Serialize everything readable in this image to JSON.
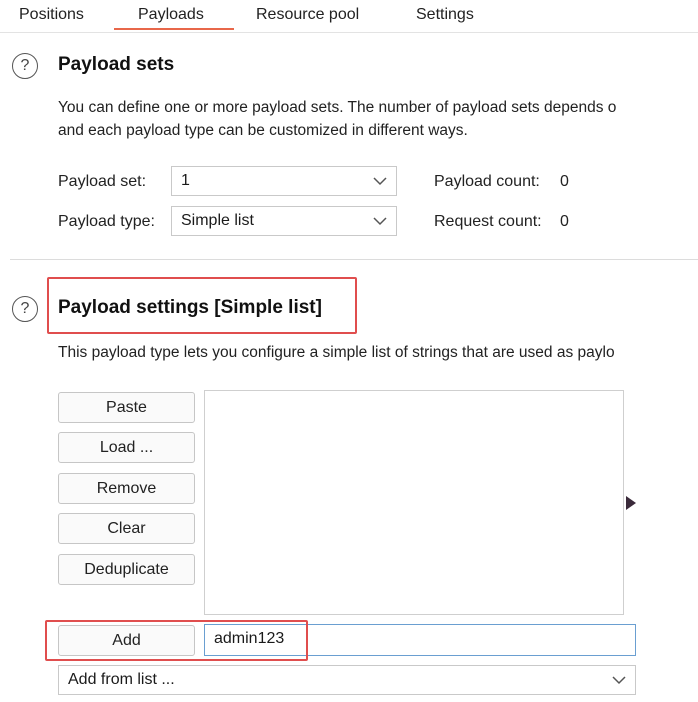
{
  "tabs": [
    {
      "label": "Positions"
    },
    {
      "label": "Payloads",
      "active": true
    },
    {
      "label": "Resource pool"
    },
    {
      "label": "Settings"
    }
  ],
  "payload_sets": {
    "title": "Payload sets",
    "description_line1": "You can define one or more payload sets. The number of payload sets depends o",
    "description_line2": "and each payload type can be customized in different ways.",
    "payload_set_label": "Payload set:",
    "payload_set_value": "1",
    "payload_type_label": "Payload type:",
    "payload_type_value": "Simple list",
    "payload_count_label": "Payload count:",
    "payload_count_value": "0",
    "request_count_label": "Request count:",
    "request_count_value": "0"
  },
  "payload_settings": {
    "title": "Payload settings [Simple list]",
    "description": "This payload type lets you configure a simple list of strings that are used as paylo",
    "buttons": {
      "paste": "Paste",
      "load": "Load ...",
      "remove": "Remove",
      "clear": "Clear",
      "deduplicate": "Deduplicate",
      "add": "Add"
    },
    "add_input_value": "admin123",
    "add_from_list_value": "Add from list ..."
  },
  "colors": {
    "accent_tab": "#e8674a",
    "highlight_box": "#e04e4e",
    "input_focus": "#6a9fd1"
  },
  "icons": [
    "help-icon",
    "chevron-down-icon",
    "expand-arrow-icon"
  ]
}
